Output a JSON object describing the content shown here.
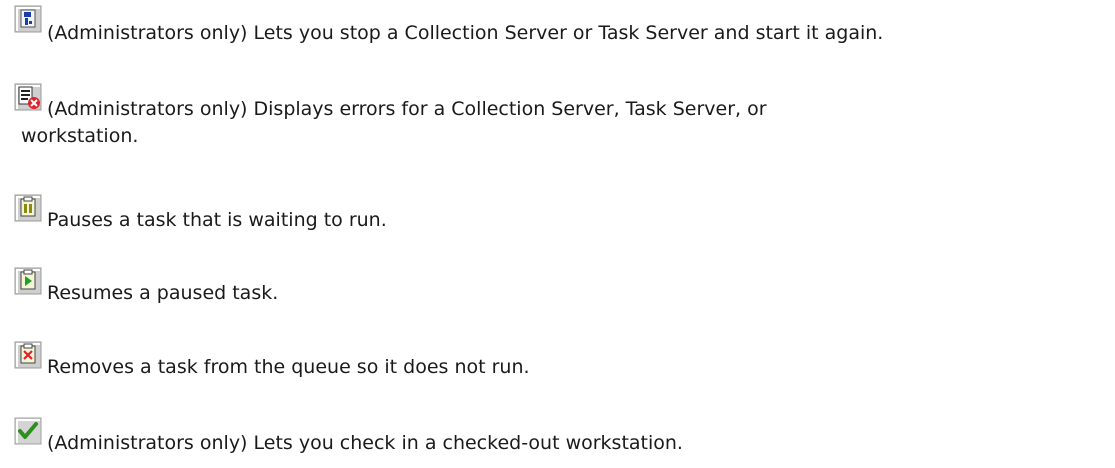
{
  "entries": [
    {
      "icon": "restart-server-icon",
      "text": "(Administrators only) Lets you stop a Collection Server or Task Server and start it again."
    },
    {
      "icon": "error-log-icon",
      "text_line1": "(Administrators only) Displays errors for a Collection Server, Task Server, or",
      "text_line2": "workstation."
    },
    {
      "icon": "pause-task-icon",
      "text": "Pauses a task that is waiting to run."
    },
    {
      "icon": "resume-task-icon",
      "text": "Resumes a paused task."
    },
    {
      "icon": "remove-task-icon",
      "text": "Removes a task from the queue so it does not run."
    },
    {
      "icon": "check-in-icon",
      "text": "(Administrators only) Lets you check in a checked-out workstation."
    }
  ],
  "colors": {
    "icon_bg": "#c8c8c8",
    "icon_border": "#8a8a8a",
    "error_red": "#e0202a",
    "resume_green": "#20a020",
    "pause_olive": "#8a8a10",
    "check_green": "#2d8f1e"
  }
}
